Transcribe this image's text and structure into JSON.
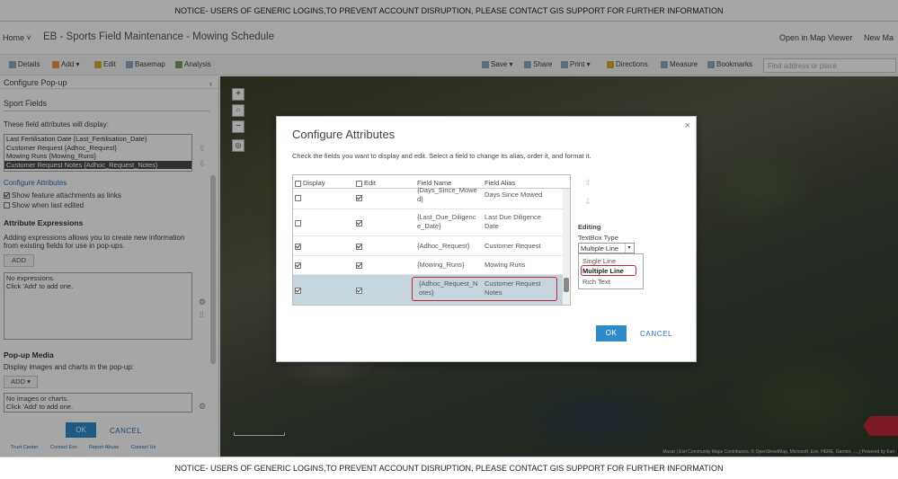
{
  "notice": {
    "text": "NOTICE- USERS OF GENERIC LOGINS,TO PREVENT ACCOUNT DISRUPTION, PLEASE CONTACT GIS SUPPORT FOR FURTHER INFORMATION"
  },
  "appbar": {
    "home": "Home ˅",
    "title": "EB - Sports Field Maintenance - Mowing Schedule",
    "open_map_viewer": "Open in Map Viewer",
    "new_map": "New Ma"
  },
  "toolbar": {
    "details": "Details",
    "add": "Add ▾",
    "edit": "Edit",
    "basemap": "Basemap",
    "analysis": "Analysis",
    "save": "Save ▾",
    "share": "Share",
    "print": "Print ▾",
    "directions": "Directions",
    "measure": "Measure",
    "bookmarks": "Bookmarks",
    "find_placeholder": "Find address or place"
  },
  "leftpanel": {
    "header": "Configure Pop-up",
    "layer": "Sport Fields",
    "display_label": "These field attributes will display:",
    "fields": [
      "Last Fertilisation Date {Last_Fertilisation_Date}",
      "Customer Request {Adhoc_Request}",
      "Mowing Runs {Mowing_Runs}",
      "Customer Request Notes {Adhoc_Request_Notes}"
    ],
    "configure_attributes": "Configure Attributes",
    "show_attachments": "Show feature attachments as links",
    "show_last_edited": "Show when last edited",
    "attr_expr_title": "Attribute Expressions",
    "attr_expr_desc": "Adding expressions allows you to create new information from existing fields for use in pop-ups.",
    "add_label": "ADD",
    "no_expressions_1": "No expressions.",
    "no_expressions_2": "Click 'Add' to add one.",
    "popup_media_title": "Pop-up Media",
    "popup_media_desc": "Display images and charts in the pop-up:",
    "add_media": "ADD ▾",
    "no_images_1": "No images or charts.",
    "no_images_2": "Click 'Add' to add one.",
    "ok": "OK",
    "cancel": "CANCEL",
    "footer": [
      "Trust Center",
      "Contact Esri",
      "Report Abuse",
      "Contact Us"
    ]
  },
  "map": {
    "attribution": "Maxar | Esri Community Maps Contributors, © OpenStreetMap, Microsoft, Esri, HERE, Garmin, ..., | Powered by Esri"
  },
  "dialog": {
    "title": "Configure Attributes",
    "description": "Check the fields you want to display and edit. Select a field to change its alias, order it, and format it.",
    "headers": {
      "display": "Display",
      "edit": "Edit",
      "field_name": "Field Name",
      "field_alias": "Field Alias"
    },
    "rows": [
      {
        "field_1": "{Days_Since_Mowe",
        "field_2": "d}",
        "alias_1": "Days Since Mowed",
        "alias_2": "",
        "display": false,
        "edit": true
      },
      {
        "field_1": "{Last_Due_Diligenc",
        "field_2": "e_Date}",
        "alias_1": "Last Due Diligence",
        "alias_2": "Date",
        "display": false,
        "edit": true
      },
      {
        "field_1": "{Adhoc_Request}",
        "field_2": "",
        "alias_1": "Customer Request",
        "alias_2": "",
        "display": true,
        "edit": true
      },
      {
        "field_1": "{Mowing_Runs}",
        "field_2": "",
        "alias_1": "Mowing Runs",
        "alias_2": "",
        "display": true,
        "edit": true
      },
      {
        "field_1": "{Adhoc_Request_N",
        "field_2": "otes}",
        "alias_1": "Customer Request",
        "alias_2": "Notes",
        "display": true,
        "edit": true
      }
    ],
    "editing": "Editing",
    "textbox_type": "TextBox Type",
    "select_value": "Multiple Line",
    "options": [
      "Single Line",
      "Multiple Line",
      "Rich Text"
    ],
    "ok": "OK",
    "cancel": "CANCEL",
    "close": "×"
  }
}
